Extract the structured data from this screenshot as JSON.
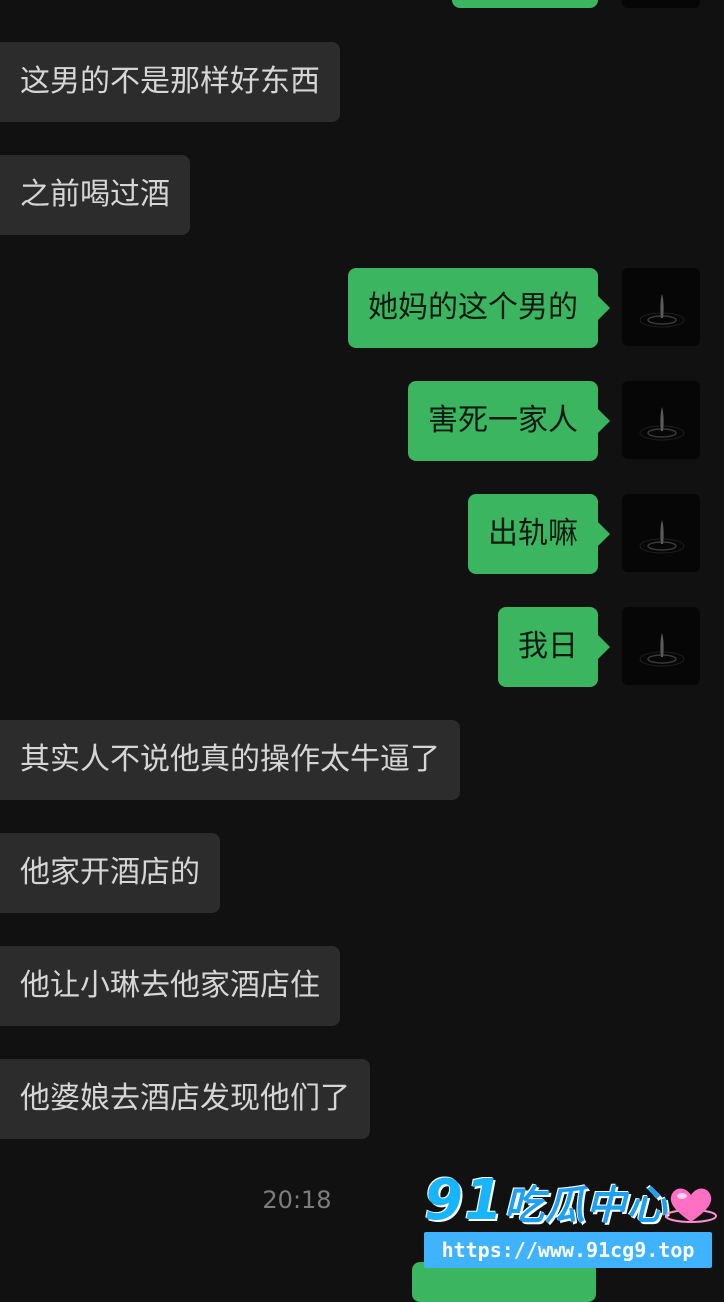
{
  "messages": [
    {
      "side": "in",
      "text": "这男的不是那样好东西"
    },
    {
      "side": "in",
      "text": "之前喝过酒"
    },
    {
      "side": "out",
      "text": "她妈的这个男的"
    },
    {
      "side": "out",
      "text": "害死一家人"
    },
    {
      "side": "out",
      "text": "出轨嘛"
    },
    {
      "side": "out",
      "text": "我日"
    },
    {
      "side": "in",
      "text": "其实人不说他真的操作太牛逼了"
    },
    {
      "side": "in",
      "text": "他家开酒店的"
    },
    {
      "side": "in",
      "text": "他让小琳去他家酒店住"
    },
    {
      "side": "in",
      "text": "他婆娘去酒店发现他们了"
    }
  ],
  "timestamp": "20:18",
  "watermark": {
    "logo_number": "91",
    "logo_text": "吃瓜中心",
    "url": "https://www.91cg9.top"
  },
  "colors": {
    "background": "#111111",
    "incoming_bubble": "#2c2c2c",
    "outgoing_bubble": "#3bb55f",
    "incoming_text": "#d6d6d6",
    "outgoing_text": "#0f1a12"
  },
  "icons": {
    "avatar": "water-drop-avatar",
    "watermark_heart": "pink-heart-icon"
  }
}
